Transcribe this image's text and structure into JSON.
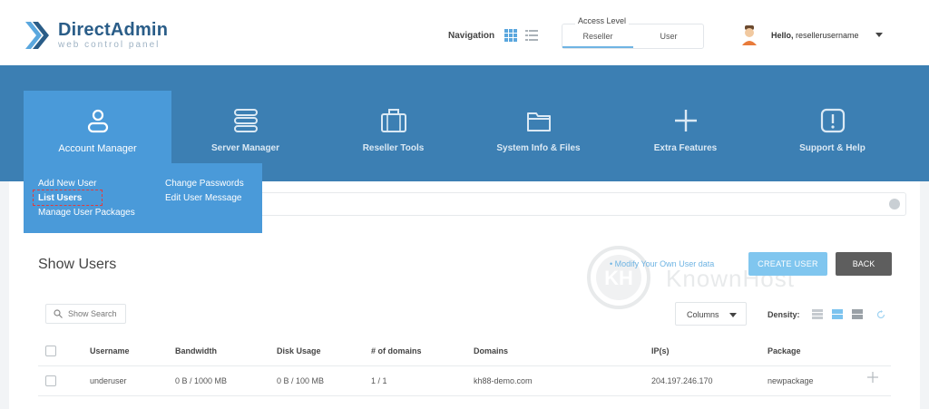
{
  "header": {
    "logo_name": "DirectAdmin",
    "logo_sub": "web control panel",
    "nav_label": "Navigation",
    "access_title": "Access Level",
    "access_options": [
      "Reseller",
      "User"
    ],
    "access_selected": "Reseller",
    "hello_prefix": "Hello,",
    "username": "resellerusername"
  },
  "menu": {
    "items": [
      {
        "label": "Account Manager",
        "icon": "user-icon"
      },
      {
        "label": "Server Manager",
        "icon": "server-icon"
      },
      {
        "label": "Reseller Tools",
        "icon": "briefcase-icon"
      },
      {
        "label": "System Info & Files",
        "icon": "folder-icon"
      },
      {
        "label": "Extra Features",
        "icon": "plus-icon"
      },
      {
        "label": "Support & Help",
        "icon": "alert-icon"
      }
    ],
    "active": "Account Manager"
  },
  "dropdown": {
    "left": [
      "Add New User",
      "List Users",
      "Manage User Packages"
    ],
    "right": [
      "Change Passwords",
      "Edit User Message"
    ],
    "highlighted": "List Users"
  },
  "page": {
    "title": "Show Users",
    "modify_link": "• Modify Your Own User data",
    "create_button": "CREATE USER",
    "back_button": "BACK",
    "watermark": "KnownHost",
    "search_placeholder": "Show Search",
    "columns_label": "Columns",
    "density_label": "Density:"
  },
  "table": {
    "headers": [
      "Username",
      "Bandwidth",
      "Disk Usage",
      "# of domains",
      "Domains",
      "IP(s)",
      "Package"
    ],
    "rows": [
      [
        "underuser",
        "0 B / 1000 MB",
        "0 B / 100 MB",
        "1 / 1",
        "kh88-demo.com",
        "204.197.246.170",
        "newpackage"
      ]
    ]
  },
  "colors": {
    "band": "#3c7fb3",
    "active_menu": "#4a9ad9",
    "create_button": "#80c6ef",
    "back_button": "#5e5e5e",
    "highlight_border": "#e23c3c"
  }
}
